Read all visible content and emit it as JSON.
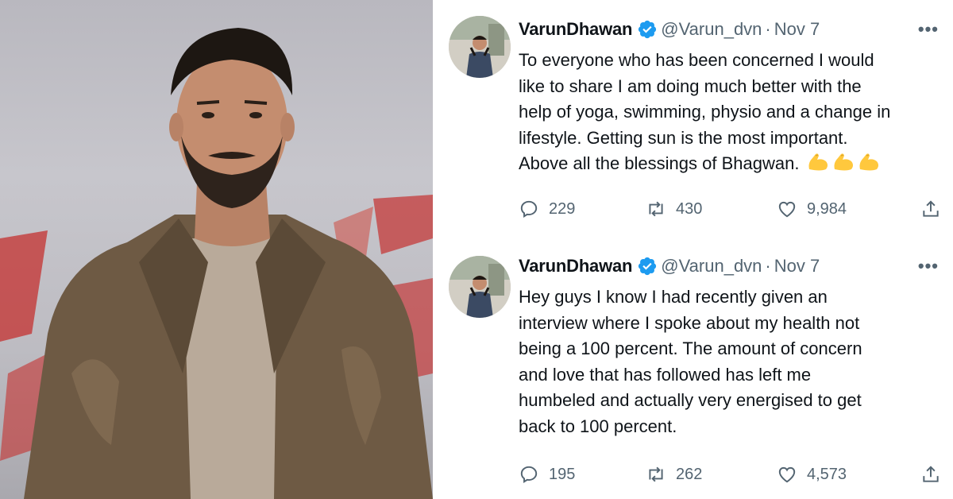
{
  "photo": {
    "alt_subject": "man in brown leather jacket and grey t-shirt",
    "colors": {
      "backdrop": "#bdbcc2",
      "jacket": "#6e5a44",
      "shirt": "#b9aa9a",
      "accent_red": "#c4302f"
    }
  },
  "tweets": [
    {
      "author_name": "VarunDhawan",
      "handle": "@Varun_dvn",
      "separator": "·",
      "date": "Nov 7",
      "more": "•••",
      "text_lines": [
        "To everyone who has been concerned I would",
        "like to share I am doing much better with the",
        "help of yoga, swimming, physio  and a change in",
        "lifestyle. Getting sun is the most important.",
        "Above all the blessings of Bhagwan."
      ],
      "emojis": [
        "flexed-biceps",
        "flexed-biceps",
        "flexed-biceps"
      ],
      "replies": "229",
      "retweets": "430",
      "likes": "9,984"
    },
    {
      "author_name": "VarunDhawan",
      "handle": "@Varun_dvn",
      "separator": "·",
      "date": "Nov 7",
      "more": "•••",
      "text_lines": [
        "Hey guys I know I had recently given an",
        "interview where I spoke about my health not",
        "being a 100 percent. The amount of concern",
        "and love that has followed has left me",
        "humbeled and actually very energised to get",
        "back to 100 percent."
      ],
      "replies": "195",
      "retweets": "262",
      "likes": "4,573"
    }
  ],
  "colors": {
    "text": "#0f1419",
    "secondary": "#536471",
    "verified_blue": "#1d9bf0",
    "emoji_yellow": "#ffc83d"
  }
}
